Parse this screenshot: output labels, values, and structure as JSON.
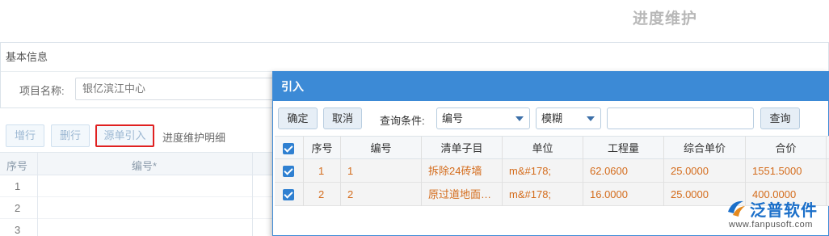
{
  "page": {
    "title": "进度维护"
  },
  "basic_info": {
    "header": "基本信息",
    "project_label": "项目名称:",
    "project_value": "银亿滨江中心"
  },
  "toolbar": {
    "add_label": "增行",
    "delete_label": "删行",
    "import_label": "源单引入",
    "detail_label": "进度维护明细"
  },
  "background_grid": {
    "columns": [
      "序号",
      "编号*"
    ],
    "rows": [
      "1",
      "2",
      "3"
    ]
  },
  "dialog": {
    "title": "引入",
    "ok_label": "确定",
    "cancel_label": "取消",
    "query_condition_label": "查询条件:",
    "field_select_value": "编号",
    "mode_select_value": "模糊",
    "search_value": "",
    "query_label": "查询",
    "columns": [
      "序号",
      "编号",
      "清单子目",
      "单位",
      "工程量",
      "综合单价",
      "合价"
    ],
    "rows": [
      {
        "no": "1",
        "code": "1",
        "item": "拆除24砖墙",
        "unit": "m&#178;",
        "qty": "62.0600",
        "price": "25.0000",
        "total": "1551.5000"
      },
      {
        "no": "2",
        "code": "2",
        "item": "原过道地面…",
        "unit": "m&#178;",
        "qty": "16.0000",
        "price": "25.0000",
        "total": "400.0000"
      }
    ]
  },
  "logo": {
    "name": "泛普软件",
    "url": "www.fanpusoft.com",
    "color": "#1b6fc9"
  },
  "colors": {
    "accent": "#3c8ad6",
    "highlight_border": "#e02020",
    "row_text": "#d46c1c"
  }
}
